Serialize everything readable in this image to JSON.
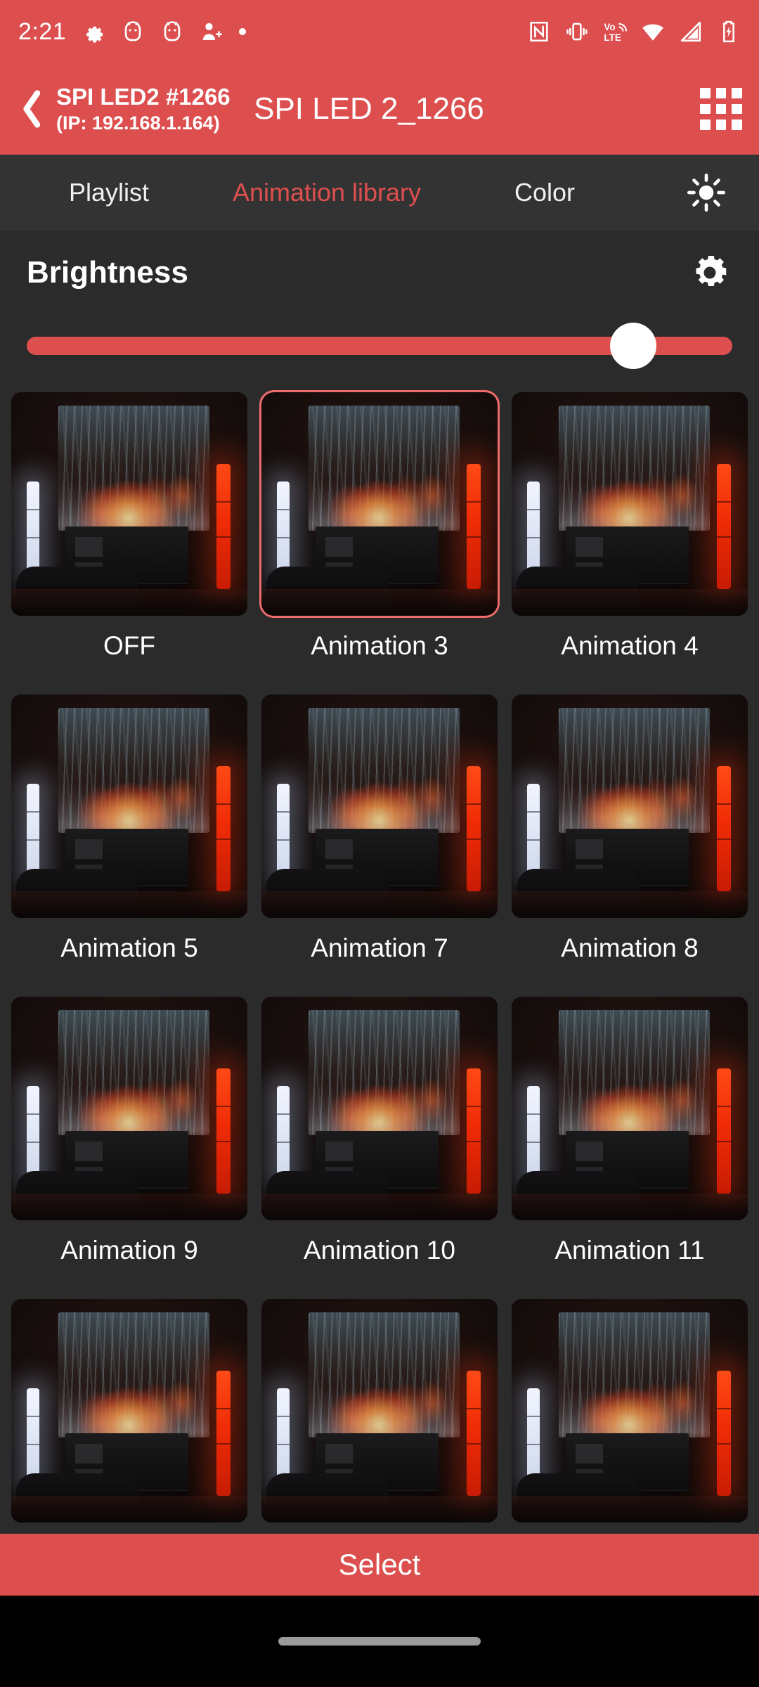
{
  "theme": {
    "accent": "#dd4f4f",
    "accent_light": "#ef6b6b",
    "tab_active": "#e04f4f",
    "bg": "#2b2b2b",
    "tabbar_bg": "#333333"
  },
  "status_bar": {
    "time": "2:21",
    "left_icons": [
      "gear-icon",
      "android-face-icon",
      "android-face-icon",
      "add-person-icon",
      "dot-icon"
    ],
    "right_icons": [
      "nfc-icon",
      "vibrate-icon",
      "volte-icon",
      "wifi-icon",
      "cell-signal-icon",
      "battery-charging-icon"
    ]
  },
  "app_bar": {
    "back_label": "back",
    "device_name": "SPI LED2 #1266",
    "device_ip": "(IP: 192.168.1.164)",
    "title": "SPI LED 2_1266",
    "grid_button": "apps-grid-icon"
  },
  "tabs": [
    {
      "label": "Playlist",
      "active": false
    },
    {
      "label": "Animation library",
      "active": true
    },
    {
      "label": "Color",
      "active": false
    }
  ],
  "tab_action_icon": "brightness-sun-icon",
  "brightness": {
    "label": "Brightness",
    "settings_icon": "gear-icon",
    "value_percent": 86
  },
  "animations": [
    {
      "label": "OFF",
      "selected": false
    },
    {
      "label": "Animation 3",
      "selected": true
    },
    {
      "label": "Animation 4",
      "selected": false
    },
    {
      "label": "Animation 5",
      "selected": false
    },
    {
      "label": "Animation 7",
      "selected": false
    },
    {
      "label": "Animation 8",
      "selected": false
    },
    {
      "label": "Animation 9",
      "selected": false
    },
    {
      "label": "Animation 10",
      "selected": false
    },
    {
      "label": "Animation 11",
      "selected": false
    },
    {
      "label": "",
      "selected": false
    },
    {
      "label": "",
      "selected": false
    },
    {
      "label": "",
      "selected": false
    }
  ],
  "footer": {
    "select_label": "Select"
  },
  "nav_bar": {
    "home_pill": "home-gesture-pill"
  }
}
